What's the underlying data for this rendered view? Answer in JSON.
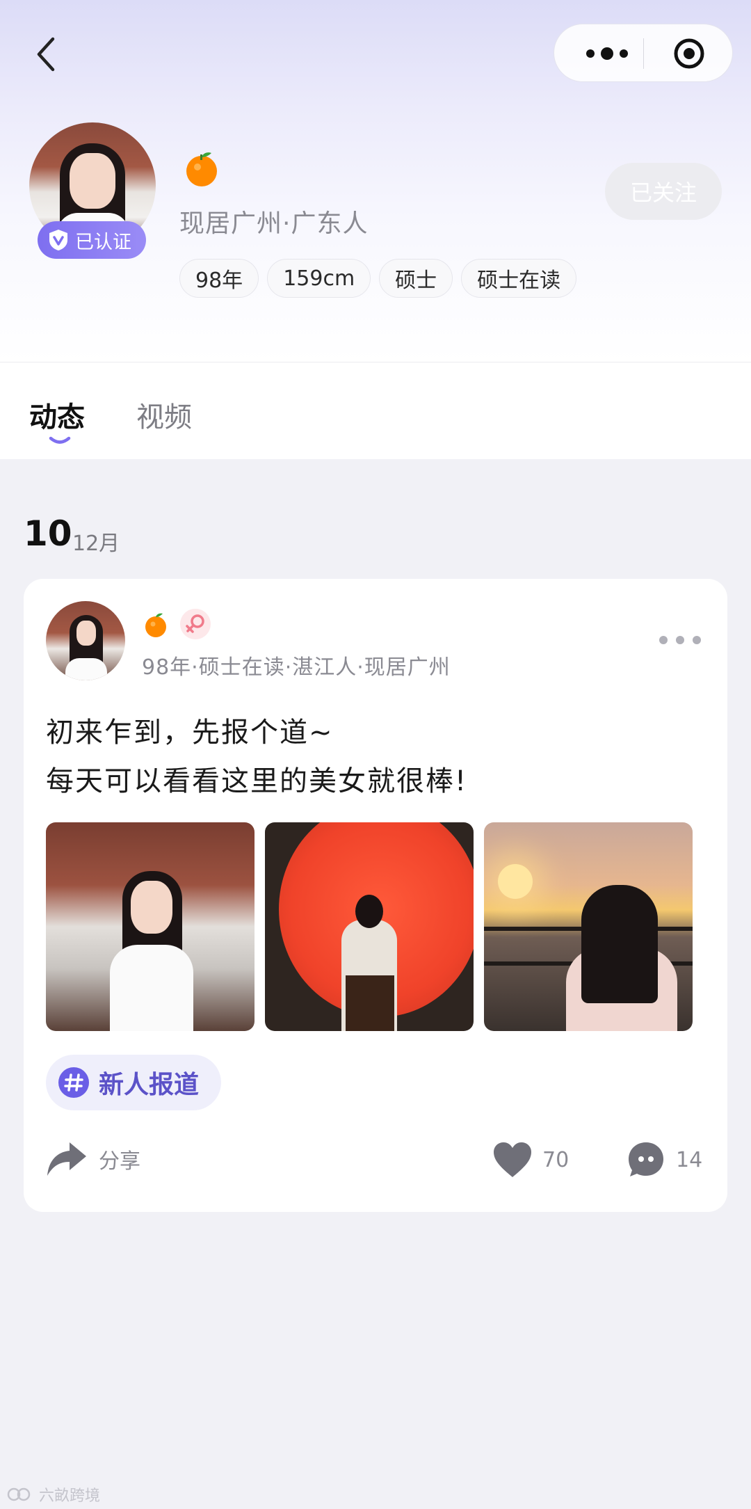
{
  "profile": {
    "verified_label": "已认证",
    "location": "现居广州·广东人",
    "follow_label": "已关注",
    "tags": [
      "98年",
      "159cm",
      "硕士",
      "硕士在读"
    ]
  },
  "tabs": [
    {
      "label": "动态"
    },
    {
      "label": "视频"
    }
  ],
  "feed": {
    "date_day": "10",
    "date_month": "12月"
  },
  "post": {
    "meta": "98年·硕士在读·湛江人·现居广州",
    "text_lines": [
      "初来乍到，先报个道~",
      "每天可以看看这里的美女就很棒!"
    ],
    "topic": "新人报道",
    "share_label": "分享",
    "like_count": "70",
    "comment_count": "14"
  },
  "watermark": "六畝跨境",
  "icons": {
    "back": "chevron-left-icon",
    "more": "more-dots-icon",
    "target": "target-icon",
    "verified": "verified-shield-icon",
    "orange": "orange-emoji-icon",
    "female": "female-symbol-icon",
    "topic": "hashtag-icon",
    "share": "share-arrow-icon",
    "like": "heart-icon",
    "comment": "comment-bubble-icon"
  },
  "colors": {
    "accent": "#7e6ff0",
    "topic_text": "#5b52c8",
    "background": "#f1f1f6"
  }
}
